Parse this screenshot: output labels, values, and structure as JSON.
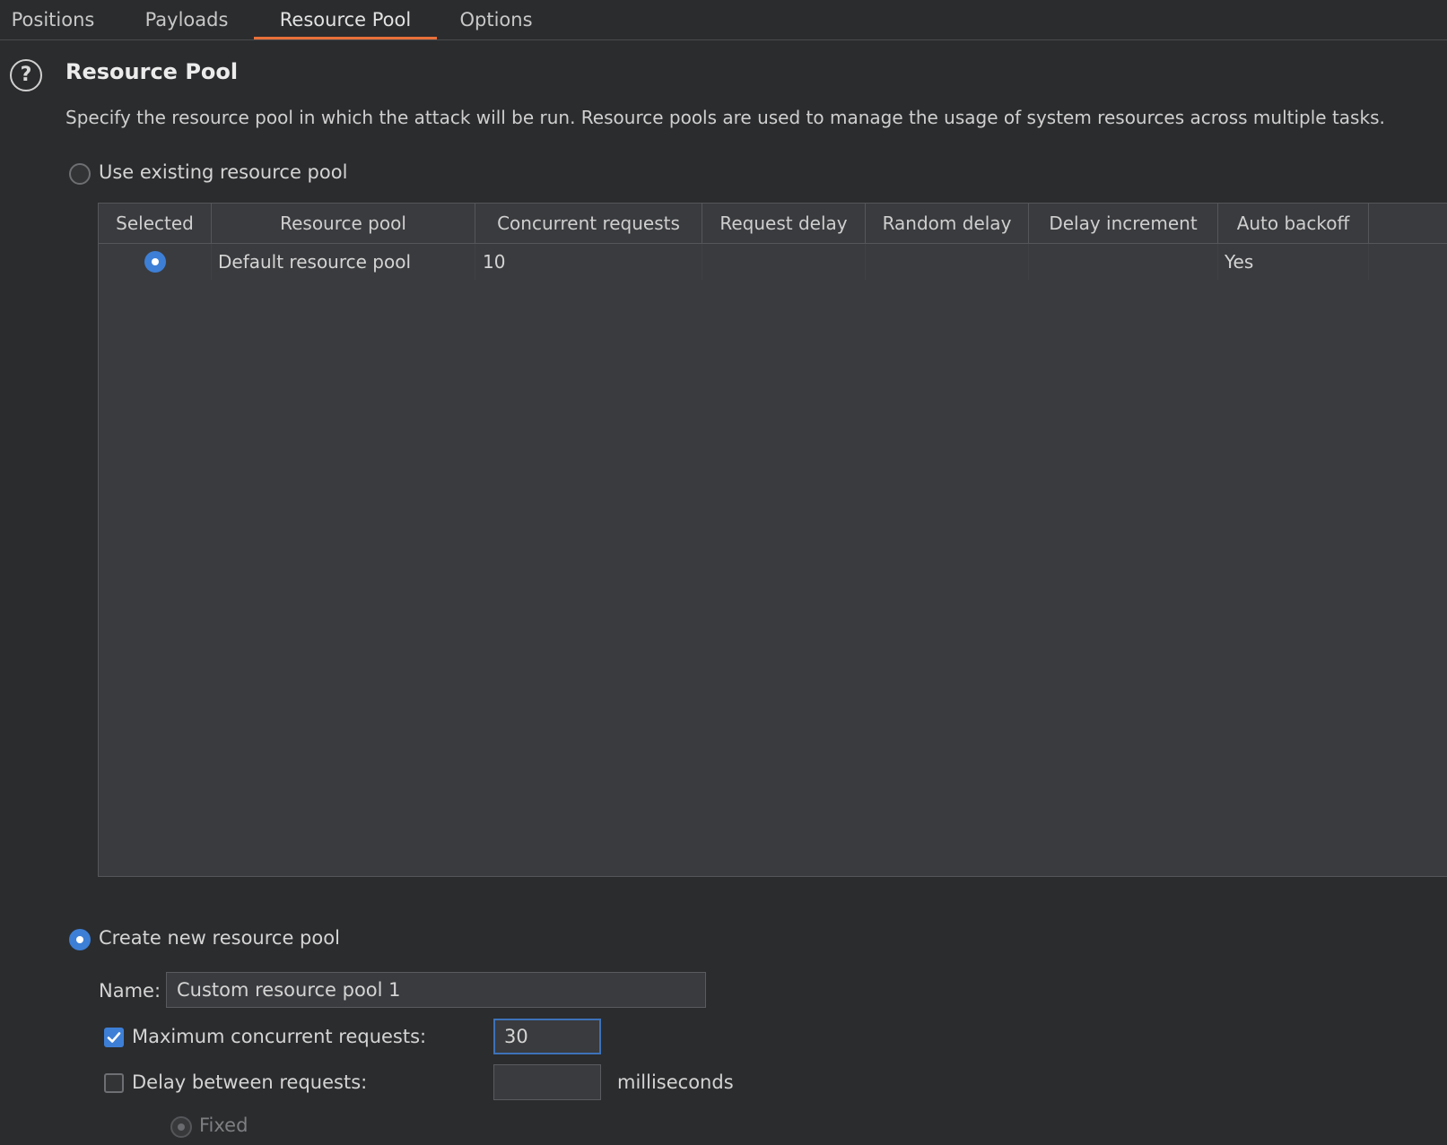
{
  "tabs": [
    {
      "label": "Positions"
    },
    {
      "label": "Payloads"
    },
    {
      "label": "Resource Pool"
    },
    {
      "label": "Options"
    }
  ],
  "active_tab": "Resource Pool",
  "section": {
    "title": "Resource Pool",
    "description": "Specify the resource pool in which the attack will be run. Resource pools are used to manage the usage of system resources across multiple tasks."
  },
  "use_existing": {
    "label": "Use existing resource pool",
    "selected": false
  },
  "table": {
    "columns": [
      "Selected",
      "Resource pool",
      "Concurrent requests",
      "Request delay",
      "Random delay",
      "Delay increment",
      "Auto backoff"
    ],
    "rows": [
      {
        "selected": true,
        "resource_pool": "Default resource pool",
        "concurrent_requests": "10",
        "request_delay": "",
        "random_delay": "",
        "delay_increment": "",
        "auto_backoff": "Yes"
      }
    ]
  },
  "create_new": {
    "label": "Create new resource pool",
    "selected": true,
    "name_label": "Name:",
    "name_value": "Custom resource pool 1",
    "max_concurrent": {
      "label": "Maximum concurrent requests:",
      "checked": true,
      "value": "30"
    },
    "delay_between": {
      "label": "Delay between requests:",
      "checked": false,
      "value": "",
      "unit": "milliseconds"
    },
    "fixed": {
      "label": "Fixed",
      "selected": true,
      "disabled": true
    }
  },
  "colors": {
    "background": "#2b2c2e",
    "accent": "#e8703a",
    "selection_blue": "#3d7fd6",
    "table_bg": "#3a3b3e"
  }
}
